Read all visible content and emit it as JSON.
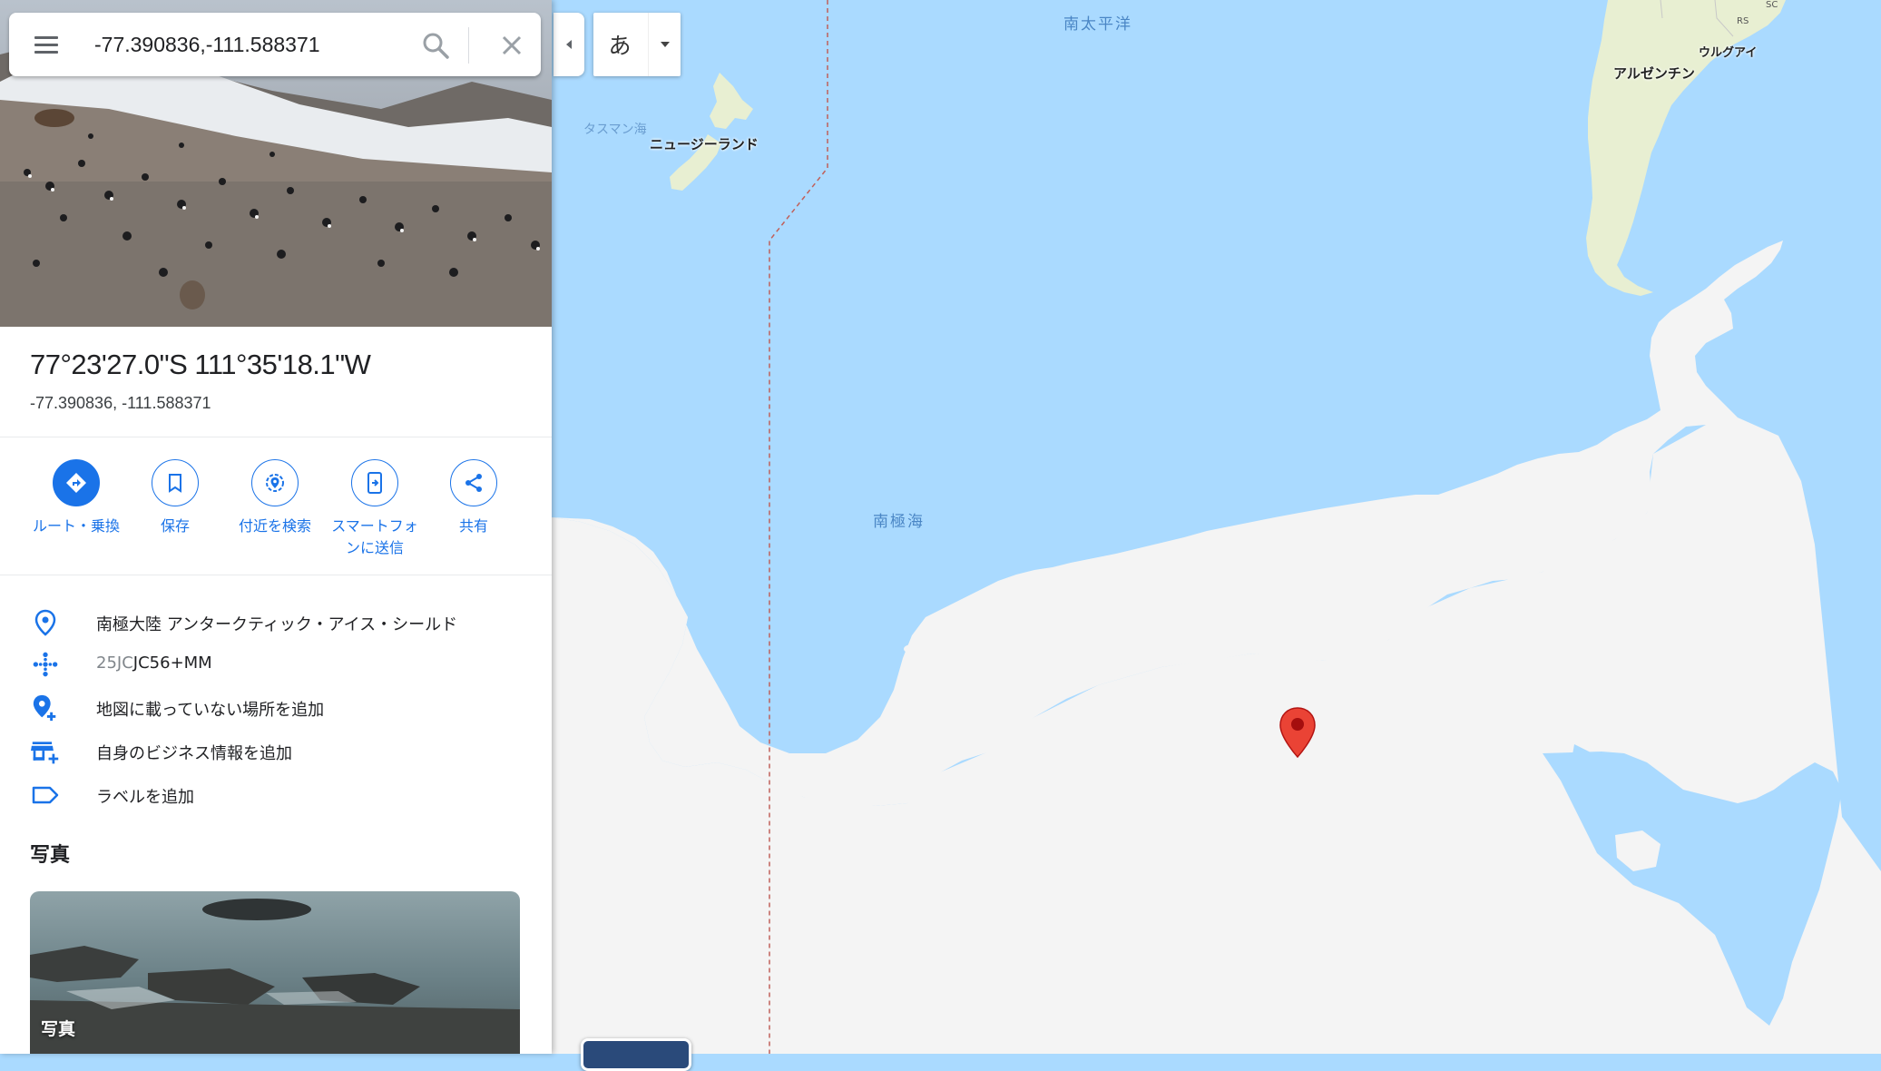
{
  "search": {
    "value": "-77.390836,-111.588371"
  },
  "place": {
    "title": "77°23'27.0\"S 111°35'18.1\"W",
    "coords": "-77.390836, -111.588371"
  },
  "actions": [
    {
      "label": "ルート・乗換",
      "icon": "directions-icon"
    },
    {
      "label": "保存",
      "icon": "bookmark-icon"
    },
    {
      "label": "付近を検索",
      "icon": "nearby-icon"
    },
    {
      "label": "スマートフォンに送信",
      "icon": "send-to-phone-icon"
    },
    {
      "label": "共有",
      "icon": "share-icon"
    }
  ],
  "info": {
    "address": "南極大陸 アンタークティック・アイス・シールド",
    "pluscode_prefix": "25JC",
    "pluscode": "JC56+MM",
    "add_place": "地図に載っていない場所を追加",
    "add_business": "自身のビジネス情報を追加",
    "add_label": "ラベルを追加"
  },
  "photos": {
    "heading": "写真",
    "caption": "写真"
  },
  "ime": {
    "char": "あ"
  },
  "map": {
    "labels": {
      "south_pacific": "南太平洋",
      "tasman_sea": "タスマン海",
      "new_zealand": "ニュージーランド",
      "southern_ocean": "南極海",
      "argentina": "アルゼンチン",
      "uruguay": "ウルグアイ",
      "rs": "RS",
      "sc": "SC"
    },
    "colors": {
      "water": "#aadaff",
      "land": "#f4f4f4",
      "green_land": "#e8efd2",
      "marker": "#ea4335",
      "accent": "#1a73e8"
    }
  }
}
